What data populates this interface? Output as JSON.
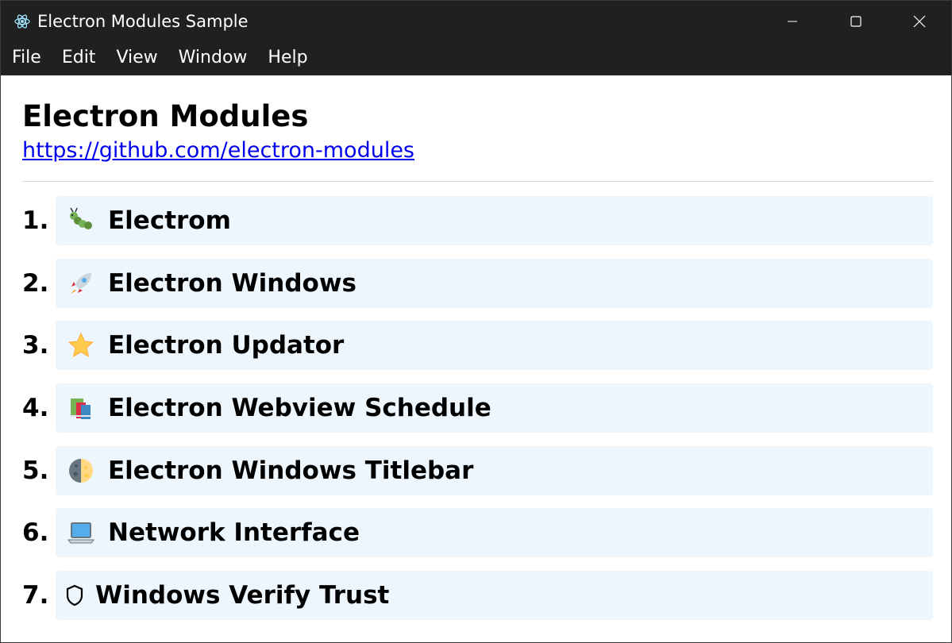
{
  "window": {
    "title": "Electron Modules Sample",
    "icon": "electron-atom-icon"
  },
  "menubar": {
    "items": [
      "File",
      "Edit",
      "View",
      "Window",
      "Help"
    ]
  },
  "main": {
    "title": "Electron Modules",
    "link": "https://github.com/electron-modules"
  },
  "list": [
    {
      "number": "1.",
      "icon": "caterpillar-icon",
      "label": "Electrom"
    },
    {
      "number": "2.",
      "icon": "rocket-icon",
      "label": "Electron Windows"
    },
    {
      "number": "3.",
      "icon": "star-icon",
      "label": "Electron Updator"
    },
    {
      "number": "4.",
      "icon": "books-icon",
      "label": "Electron Webview Schedule"
    },
    {
      "number": "5.",
      "icon": "half-moon-icon",
      "label": "Electron Windows Titlebar"
    },
    {
      "number": "6.",
      "icon": "laptop-icon",
      "label": "Network Interface"
    },
    {
      "number": "7.",
      "icon": "shield-icon",
      "label": "Windows Verify Trust"
    }
  ],
  "colors": {
    "titlebar_bg": "#202020",
    "row_bg": "#eef6fd",
    "link": "#0000ee"
  }
}
